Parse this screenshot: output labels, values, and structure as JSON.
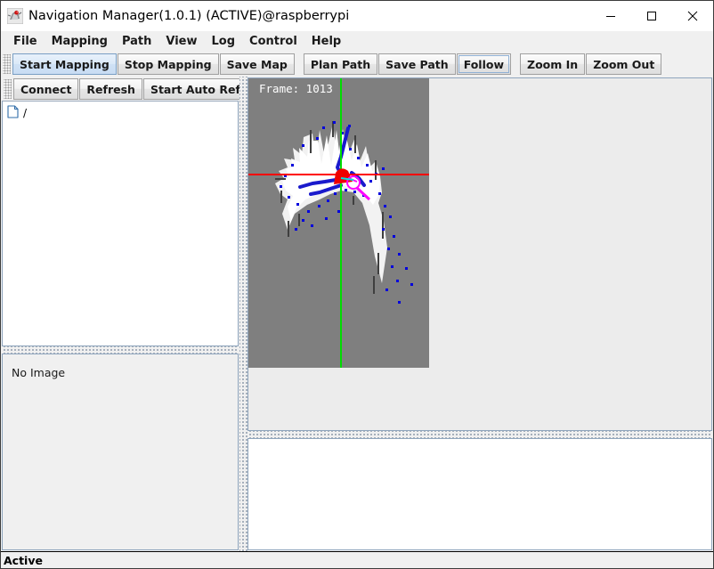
{
  "window": {
    "title": "Navigation Manager(1.0.1) (ACTIVE)@raspberrypi",
    "app_icon": "robot-app-icon",
    "minimize_label": "—",
    "maximize_label": "□",
    "close_label": "✕"
  },
  "menubar": {
    "items": [
      {
        "label": "File"
      },
      {
        "label": "Mapping"
      },
      {
        "label": "Path"
      },
      {
        "label": "View"
      },
      {
        "label": "Log"
      },
      {
        "label": "Control"
      },
      {
        "label": "Help"
      }
    ]
  },
  "toolbar": {
    "groups": [
      {
        "buttons": [
          {
            "label": "Start Mapping",
            "state": "selected"
          },
          {
            "label": "Stop Mapping",
            "state": "normal"
          },
          {
            "label": "Save Map",
            "state": "normal"
          }
        ]
      },
      {
        "buttons": [
          {
            "label": "Plan Path",
            "state": "normal"
          },
          {
            "label": "Save Path",
            "state": "normal"
          },
          {
            "label": "Follow",
            "state": "focused"
          }
        ]
      },
      {
        "buttons": [
          {
            "label": "Zoom In",
            "state": "normal"
          },
          {
            "label": "Zoom Out",
            "state": "normal"
          }
        ]
      }
    ]
  },
  "left_panel": {
    "tree_toolbar": {
      "buttons": [
        {
          "label": "Connect"
        },
        {
          "label": "Refresh"
        },
        {
          "label": "Start Auto Refresh"
        }
      ]
    },
    "tree": {
      "items": [
        {
          "icon": "file-icon",
          "label": "/"
        }
      ]
    },
    "image_preview": {
      "empty_label": "No Image"
    }
  },
  "map_panel": {
    "frame_label": "Frame: 1013",
    "colors": {
      "unknown": "#7f7f7f",
      "free": "#ffffff",
      "occupied": "#4a4a4a",
      "axis_x": "#ff0000",
      "axis_y": "#00dd00",
      "robot": "#ee0000",
      "scan_point": "#0000dd",
      "path": "#ff00ff",
      "trajectory": "#1a1acc"
    }
  },
  "log_panel": {
    "text": ""
  },
  "statusbar": {
    "text": "Active"
  }
}
